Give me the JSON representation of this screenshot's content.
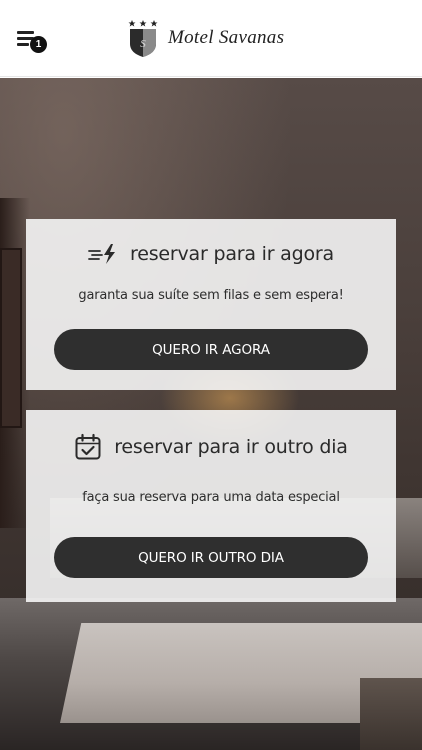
{
  "header": {
    "menu_badge": "1",
    "brand_name": "Motel Savanas",
    "logo_icon": "shield-crest-icon"
  },
  "cards": [
    {
      "title": "reservar para ir agora",
      "subtitle": "garanta sua suíte sem filas e sem espera!",
      "button_label": "QUERO IR AGORA",
      "icon": "lightning-speed-icon"
    },
    {
      "title": "reservar para ir outro dia",
      "subtitle": "faça sua reserva para uma data especial",
      "button_label": "QUERO IR OUTRO DIA",
      "icon": "calendar-check-icon"
    }
  ],
  "colors": {
    "button_bg": "#2f2f2f",
    "card_bg": "rgba(245,245,245,0.90)",
    "text": "#2a2a2a"
  }
}
